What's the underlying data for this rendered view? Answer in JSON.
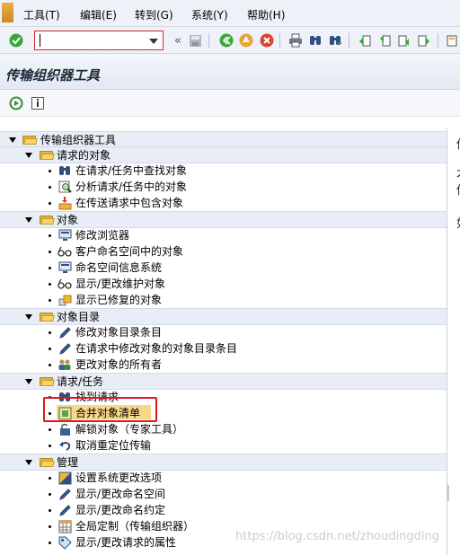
{
  "menubar": {
    "items": [
      "工具(T)",
      "编辑(E)",
      "转到(G)",
      "系统(Y)",
      "帮助(H)"
    ]
  },
  "toolbar": {
    "command_value": "",
    "buttons": [
      "check-icon",
      "back-icon",
      "save-icon",
      "exit-icon",
      "cancel-icon",
      "print-icon",
      "find-icon",
      "find-next-icon",
      "first-page-icon",
      "prev-page-icon",
      "next-page-icon",
      "last-page-icon"
    ]
  },
  "page": {
    "title": "传输组织器工具"
  },
  "tree": {
    "root": "传输组织器工具",
    "groups": [
      {
        "label": "请求的对象",
        "items": [
          "在请求/任务中查找对象",
          "分析请求/任务中的对象",
          "在传送请求中包含对象"
        ]
      },
      {
        "label": "对象",
        "items": [
          "修改浏览器",
          "客户命名空间中的对象",
          "命名空间信息系统",
          "显示/更改维护对象",
          "显示已修复的对象"
        ]
      },
      {
        "label": "对象目录",
        "items": [
          "修改对象目录条目",
          "在请求中修改对象的对象目录条目",
          "更改对象的所有者"
        ]
      },
      {
        "label": "请求/任务",
        "items": [
          "找到请求",
          "合并对象清单",
          "解锁对象（专家工具）",
          "取消重定位传输"
        ]
      },
      {
        "label": "管理",
        "items": [
          "设置系统更改选项",
          "显示/更改命名空间",
          "显示/更改命名约定",
          "全局定制（传输组织器）",
          "显示/更改请求的属性"
        ]
      }
    ]
  },
  "rightpane": {
    "chars": [
      "传",
      "才",
      "传",
      "如"
    ]
  },
  "watermark": "https://blog.csdn.net/zhoudingding",
  "colors": {
    "highlight_border": "#e0161c",
    "folder": "#f7d36a",
    "selected_bg": "#f7d88a"
  }
}
